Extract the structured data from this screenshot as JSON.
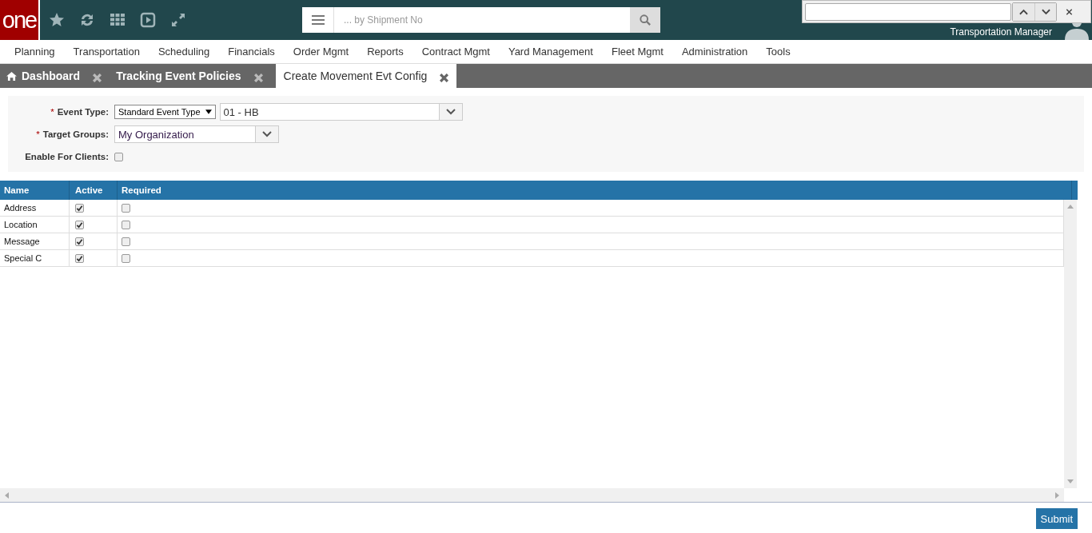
{
  "header": {
    "logo": "one",
    "search": {
      "placeholder": "... by Shipment No"
    },
    "user_role": "Transportation Manager"
  },
  "menu": [
    "Planning",
    "Transportation",
    "Scheduling",
    "Financials",
    "Order Mgmt",
    "Reports",
    "Contract Mgmt",
    "Yard Management",
    "Fleet Mgmt",
    "Administration",
    "Tools"
  ],
  "tabs": [
    {
      "label": "Dashboard",
      "kind": "home",
      "selected": false
    },
    {
      "label": "Tracking Event Policies",
      "kind": "plain",
      "selected": false
    },
    {
      "label": "Create Movement Evt Config",
      "kind": "plain",
      "selected": true
    }
  ],
  "form": {
    "event_type": {
      "label": "Event Type:",
      "required_mark": "*",
      "type_select": "Standard Event Type",
      "value": "01 - HB"
    },
    "target_groups": {
      "label": "Target Groups:",
      "required_mark": "*",
      "value": "My Organization"
    },
    "enable_for_clients": {
      "label": "Enable For Clients:",
      "checked": false
    }
  },
  "table": {
    "columns": [
      "Name",
      "Active",
      "Required"
    ],
    "rows": [
      {
        "name": "Address",
        "active": true,
        "required": false
      },
      {
        "name": "Location",
        "active": true,
        "required": false
      },
      {
        "name": "Message",
        "active": true,
        "required": false
      },
      {
        "name": "Special C",
        "active": true,
        "required": false
      }
    ]
  },
  "submit": "Submit"
}
